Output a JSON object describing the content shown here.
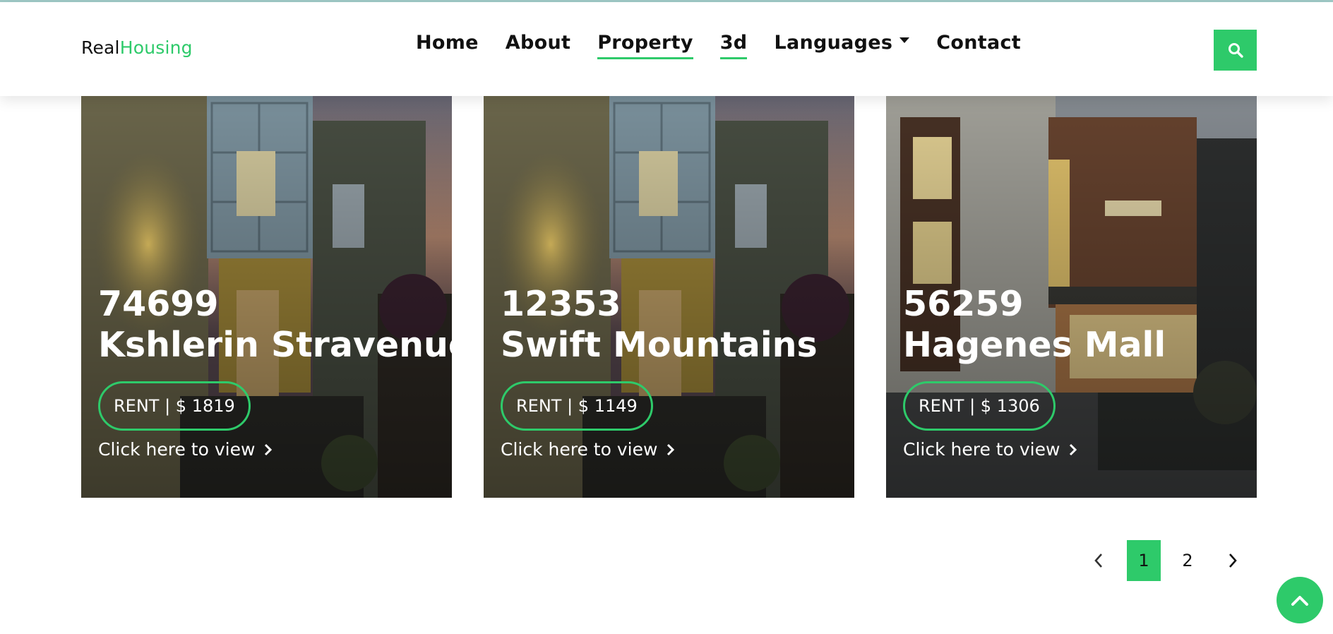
{
  "brand": {
    "part1": "Real",
    "part2": "Housing"
  },
  "nav": {
    "items": [
      {
        "label": "Home"
      },
      {
        "label": "About"
      },
      {
        "label": "Property"
      },
      {
        "label": "3d"
      },
      {
        "label": "Languages"
      },
      {
        "label": "Contact"
      }
    ]
  },
  "properties": [
    {
      "number": "74699",
      "street": "Kshlerin Stravenue",
      "rent": "RENT | $ 1819",
      "link": "Click here to view"
    },
    {
      "number": "12353",
      "street": "Swift Mountains",
      "rent": "RENT | $ 1149",
      "link": "Click here to view"
    },
    {
      "number": "56259",
      "street": "Hagenes Mall",
      "rent": "RENT | $ 1306",
      "link": "Click here to view"
    }
  ],
  "pagination": {
    "pages": [
      "1",
      "2"
    ],
    "current": "1"
  },
  "icons": {
    "search": "search-icon",
    "prev": "chevron-left-icon",
    "next": "chevron-right-icon",
    "back_to_top": "chevron-up-icon"
  },
  "colors": {
    "accent": "#2eca6a",
    "text": "#111111"
  }
}
